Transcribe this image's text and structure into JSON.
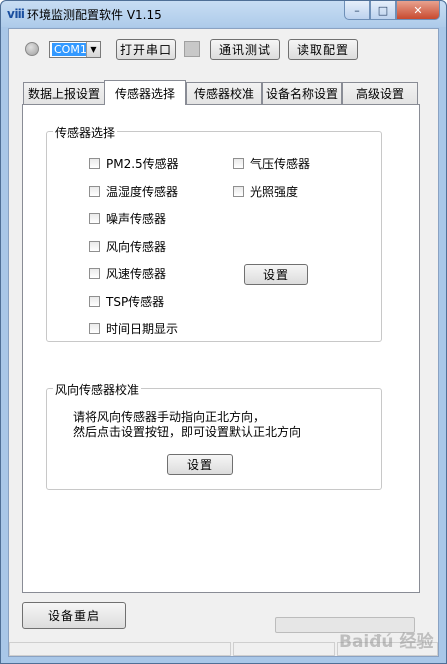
{
  "window": {
    "title": "环境监测配置软件 V1.15",
    "app_icon": "ⅷ",
    "buttons": {
      "minimize": "–",
      "maximize": "□",
      "close": "✕"
    }
  },
  "toolbar": {
    "port_value": "COM1",
    "dropdown_arrow": "▼",
    "open_port_label": "打开串口",
    "comm_test_label": "通讯测试",
    "read_config_label": "读取配置"
  },
  "tabs": [
    {
      "label": "数据上报设置"
    },
    {
      "label": "传感器选择"
    },
    {
      "label": "传感器校准"
    },
    {
      "label": "设备名称设置"
    },
    {
      "label": "高级设置"
    }
  ],
  "sensor_group": {
    "title": "传感器选择",
    "left_items": [
      "PM2.5传感器",
      "温湿度传感器",
      "噪声传感器",
      "风向传感器",
      "风速传感器",
      "TSP传感器",
      "时间日期显示"
    ],
    "right_items": [
      "气压传感器",
      "光照强度"
    ],
    "set_button": "设置"
  },
  "wind_group": {
    "title": "风向传感器校准",
    "line1": "请将风向传感器手动指向正北方向，",
    "line2": "然后点击设置按钮，即可设置默认正北方向",
    "set_button": "设置"
  },
  "footer": {
    "reboot_button": "设备重启",
    "watermark": "Baiđú 经验"
  },
  "colors": {
    "title_bar": "#aecbea",
    "close_button": "#c84a2f",
    "selection": "#3399ff"
  }
}
